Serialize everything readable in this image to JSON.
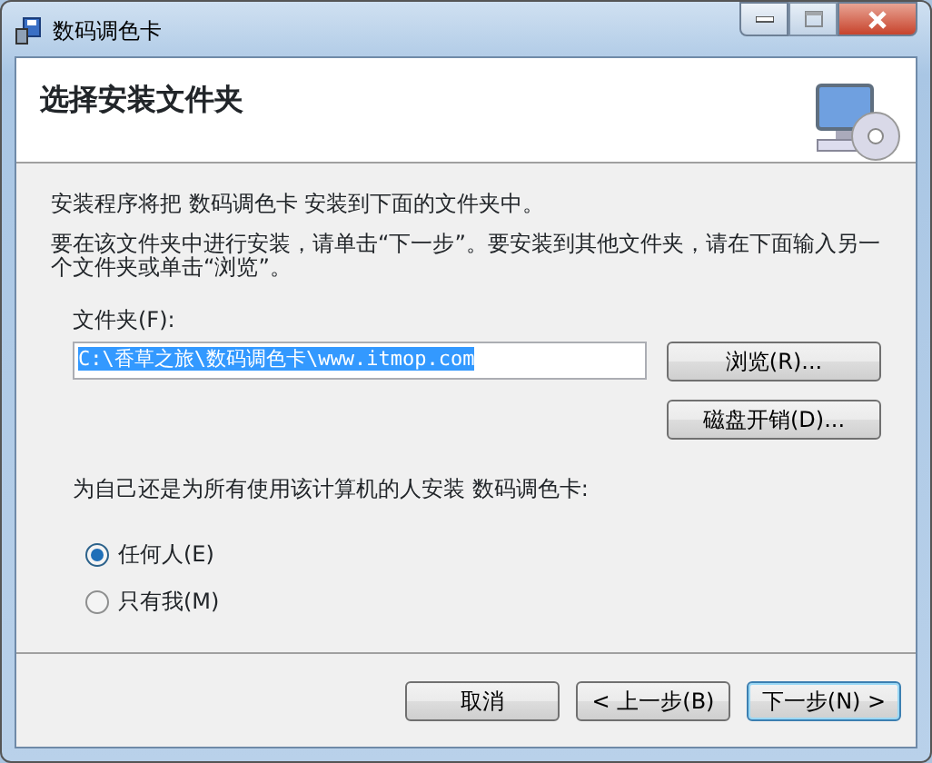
{
  "window": {
    "title": "数码调色卡"
  },
  "header": {
    "title": "选择安装文件夹"
  },
  "intro": "安装程序将把 数码调色卡 安装到下面的文件夹中。",
  "instruction": "要在该文件夹中进行安装，请单击“下一步”。要安装到其他文件夹，请在下面输入另一个文件夹或单击“浏览”。",
  "folder": {
    "label": "文件夹(F):",
    "value": "C:\\香草之旅\\数码调色卡\\www.itmop.com",
    "text_selected": true
  },
  "side_buttons": [
    "浏览(R)...",
    "磁盘开销(D)..."
  ],
  "install_for": {
    "question": "为自己还是为所有使用该计算机的人安装 数码调色卡:",
    "options": [
      {
        "label": "任何人(E)",
        "selected": true
      },
      {
        "label": "只有我(M)",
        "selected": false
      }
    ]
  },
  "buttons": [
    {
      "label": "取消",
      "default": false
    },
    {
      "label": "< 上一步(B)",
      "default": false
    },
    {
      "label": "下一步(N) >",
      "default": true
    }
  ]
}
